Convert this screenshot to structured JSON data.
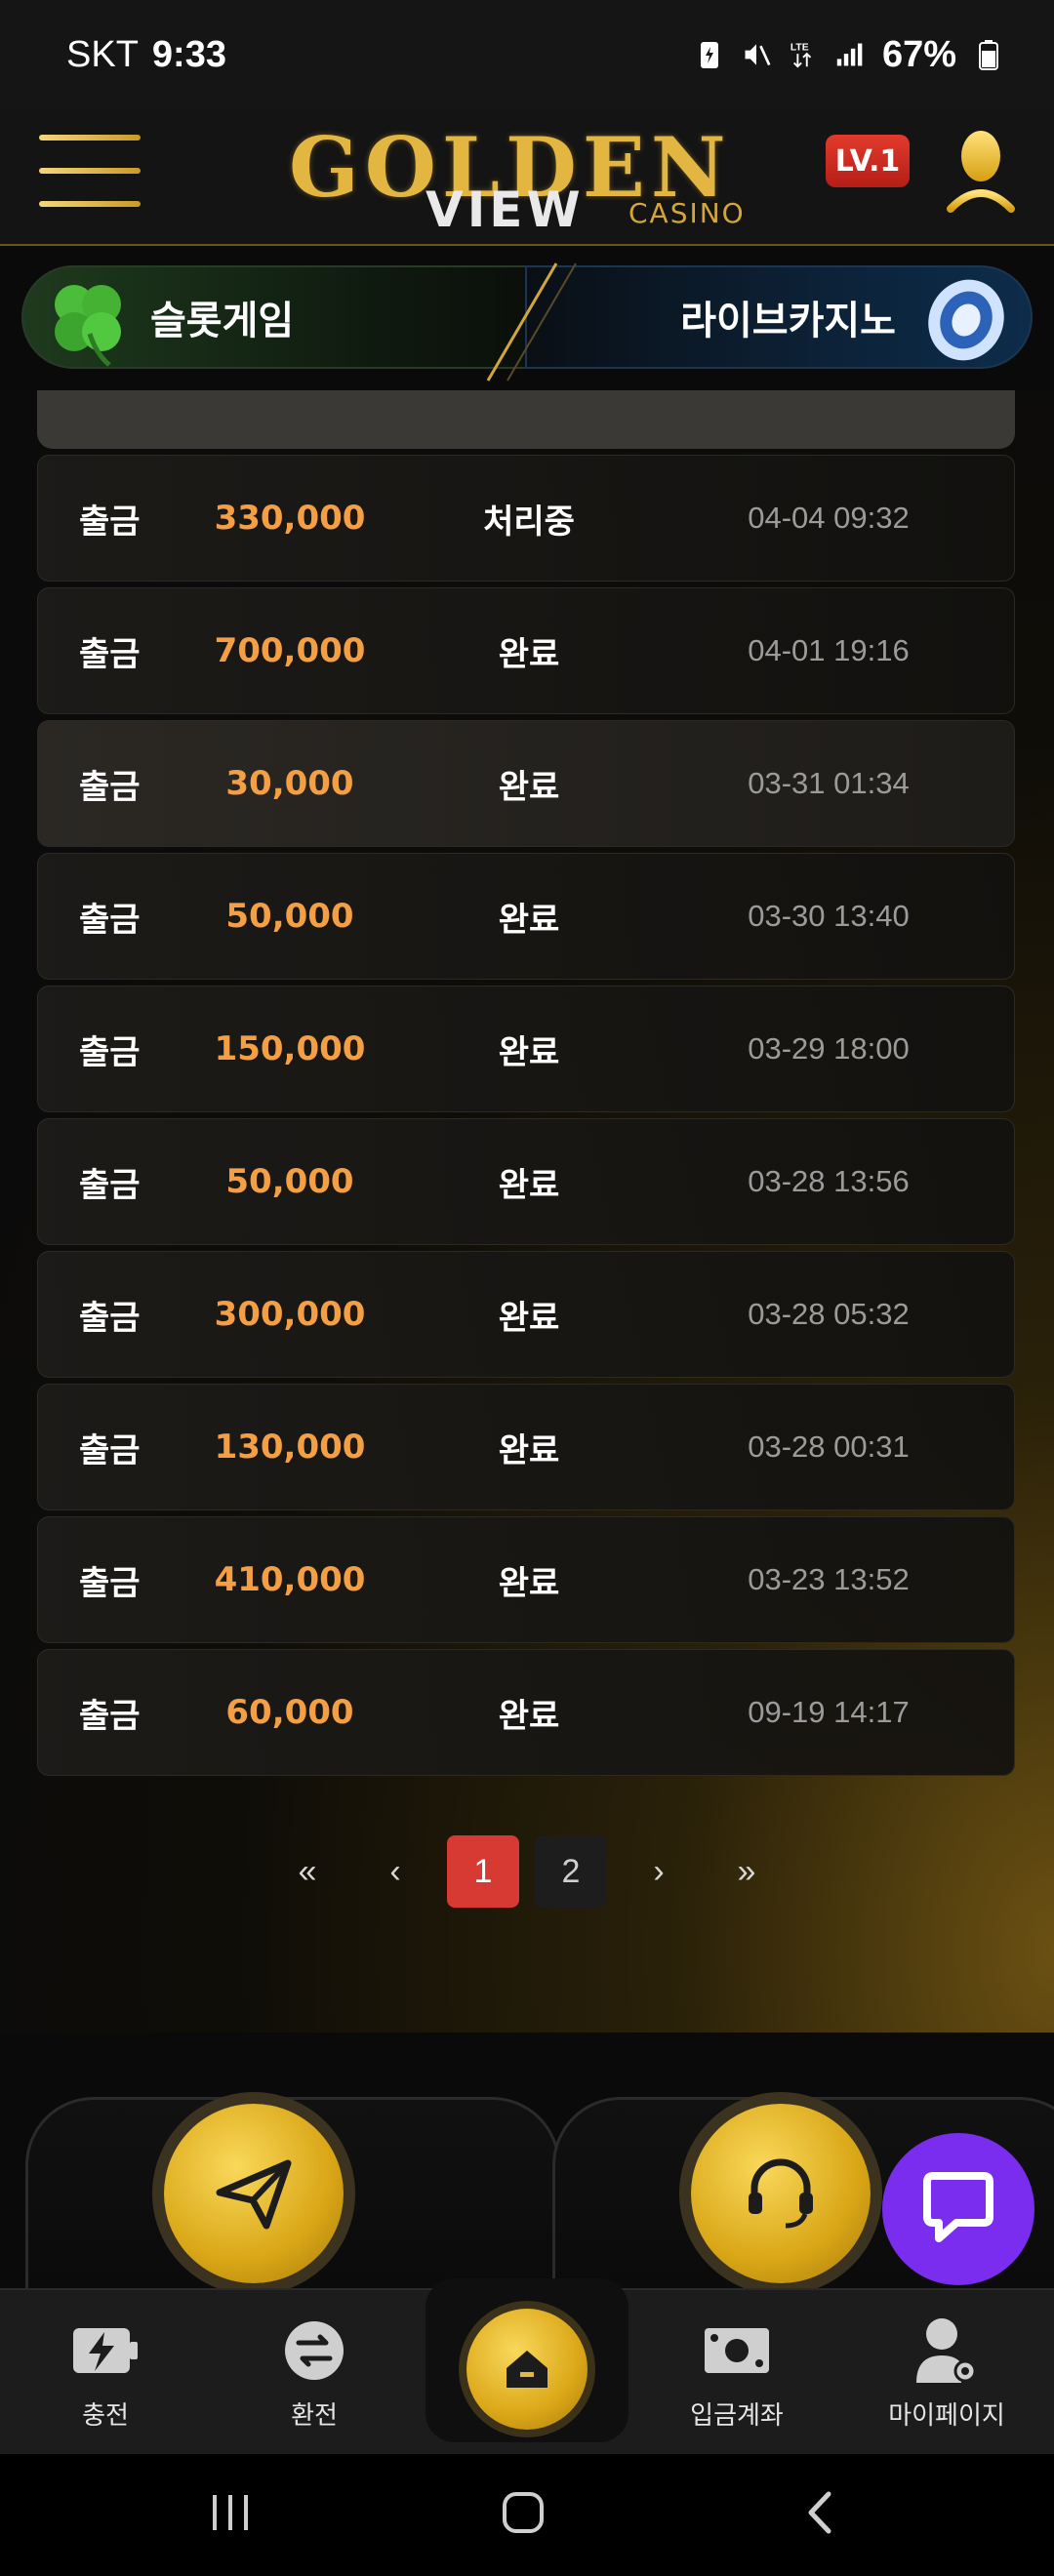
{
  "status_bar": {
    "carrier": "SKT",
    "time": "9:33",
    "battery": "67%"
  },
  "header": {
    "logo_main": "GOLDEN",
    "logo_sub": "VIEW",
    "logo_tag": "CASINO",
    "level": "LV.1"
  },
  "game_tabs": {
    "slot_label": "슬롯게임",
    "live_label": "라이브카지노"
  },
  "history": {
    "rows": [
      {
        "type": "출금",
        "amount": "330,000",
        "status": "처리중",
        "date": "04-04 09:32"
      },
      {
        "type": "출금",
        "amount": "700,000",
        "status": "완료",
        "date": "04-01 19:16"
      },
      {
        "type": "출금",
        "amount": "30,000",
        "status": "완료",
        "date": "03-31 01:34"
      },
      {
        "type": "출금",
        "amount": "50,000",
        "status": "완료",
        "date": "03-30 13:40"
      },
      {
        "type": "출금",
        "amount": "150,000",
        "status": "완료",
        "date": "03-29 18:00"
      },
      {
        "type": "출금",
        "amount": "50,000",
        "status": "완료",
        "date": "03-28 13:56"
      },
      {
        "type": "출금",
        "amount": "300,000",
        "status": "완료",
        "date": "03-28 05:32"
      },
      {
        "type": "출금",
        "amount": "130,000",
        "status": "완료",
        "date": "03-28 00:31"
      },
      {
        "type": "출금",
        "amount": "410,000",
        "status": "완료",
        "date": "03-23 13:52"
      },
      {
        "type": "출금",
        "amount": "60,000",
        "status": "완료",
        "date": "09-19 14:17"
      }
    ]
  },
  "pagination": {
    "first": "«",
    "prev": "‹",
    "page1": "1",
    "page2": "2",
    "next": "›",
    "last": "»"
  },
  "bottom_nav": {
    "charge": "충전",
    "exchange": "환전",
    "deposit_account": "입금계좌",
    "my_page": "마이페이지"
  },
  "colors": {
    "accent_gold": "#e2b640",
    "amount_orange": "#f59f44",
    "active_page": "#d63a32",
    "chat_purple": "#7a2dee"
  }
}
